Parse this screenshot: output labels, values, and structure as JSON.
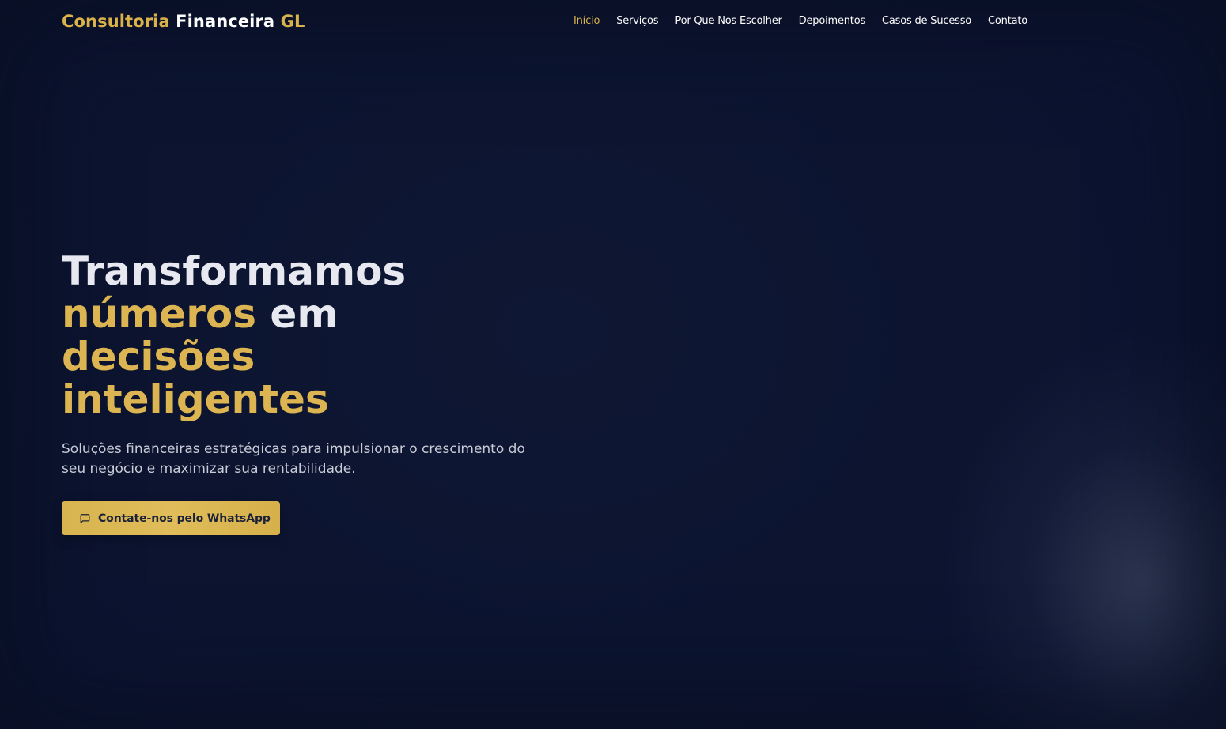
{
  "header": {
    "logo": {
      "part1": "Consultoria",
      "part2": "Financeira",
      "part3": "GL"
    },
    "nav": [
      {
        "label": "Início",
        "active": true
      },
      {
        "label": "Serviços",
        "active": false
      },
      {
        "label": "Por Que Nos Escolher",
        "active": false
      },
      {
        "label": "Depoimentos",
        "active": false
      },
      {
        "label": "Casos de Sucesso",
        "active": false
      },
      {
        "label": "Contato",
        "active": false
      }
    ]
  },
  "hero": {
    "headline": {
      "line1": "Transformamos",
      "line2_gold": "números",
      "line2_rest": "em",
      "line3": "decisões",
      "line4": "inteligentes"
    },
    "subtitle": "Soluções financeiras estratégicas para impulsionar o crescimento do seu negócio e maximizar sua rentabilidade.",
    "cta": {
      "label": "Contate-nos pelo WhatsApp",
      "icon": "message-square-icon"
    }
  },
  "colors": {
    "background": "#0c1431",
    "accent_gold": "#d9b24a",
    "text_light": "#e8e9f0",
    "text_muted": "#c9cbd6",
    "cta_text": "#1b2138"
  }
}
